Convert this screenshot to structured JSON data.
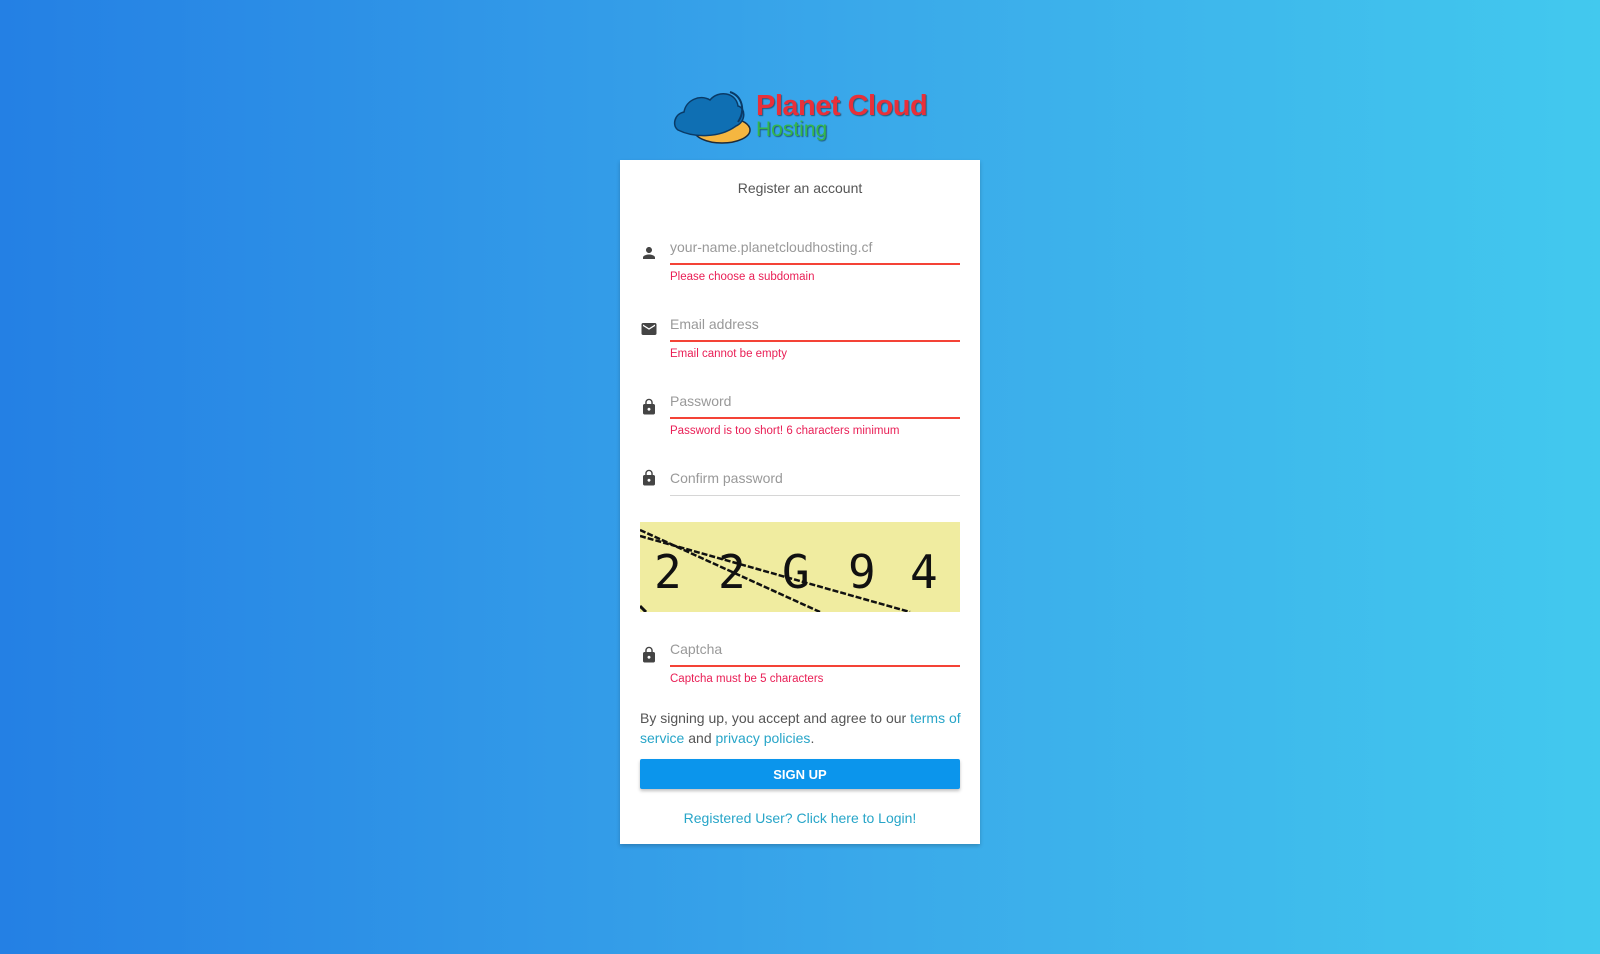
{
  "brand": {
    "name_line1": "Planet Cloud",
    "name_line2": "Hosting",
    "colors": {
      "line1": "#e8303a",
      "line2": "#35b64a",
      "cloud_blue": "#0f6fb3",
      "cloud_yellow": "#f5b640"
    }
  },
  "form": {
    "title": "Register an account",
    "fields": [
      {
        "name": "subdomain",
        "icon": "person-icon",
        "placeholder": "your-name.planetcloudhosting.cf",
        "value": "",
        "error": "Please choose a subdomain"
      },
      {
        "name": "email",
        "icon": "mail-icon",
        "placeholder": "Email address",
        "value": "",
        "error": "Email cannot be empty"
      },
      {
        "name": "password",
        "icon": "lock-icon",
        "placeholder": "Password",
        "value": "",
        "error": "Password is too short! 6 characters minimum"
      },
      {
        "name": "confirm_password",
        "icon": "lock-icon",
        "placeholder": "Confirm password",
        "value": "",
        "error": ""
      },
      {
        "name": "captcha",
        "icon": "lock-icon",
        "placeholder": "Captcha",
        "value": "",
        "error": "Captcha must be 5 characters"
      }
    ],
    "captcha_image_text": [
      "2",
      "2",
      "G",
      "9",
      "4"
    ],
    "terms": {
      "prefix": "By signing up, you accept and agree to our ",
      "terms_link": "terms of service",
      "middle": " and ",
      "privacy_link": "privacy policies",
      "suffix": "."
    },
    "submit_label": "SIGN UP",
    "login_link": "Registered User? Click here to Login!"
  },
  "colors": {
    "error": "#e91e55",
    "error_line": "#f44336",
    "link": "#27a5c8",
    "button": "#0b95ec"
  }
}
